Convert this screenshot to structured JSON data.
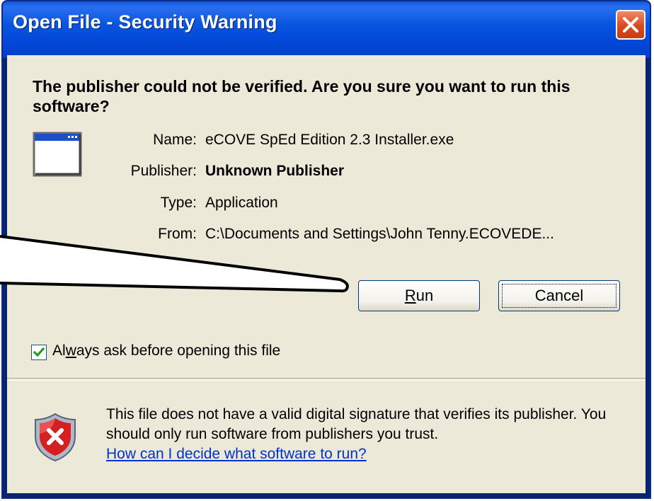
{
  "window": {
    "title": "Open File - Security Warning"
  },
  "dialog": {
    "heading": "The publisher could not be verified.  Are you sure you want to run this software?",
    "fields": {
      "name_label": "Name:",
      "name_value": "eCOVE SpEd Edition 2.3 Installer.exe",
      "publisher_label": "Publisher:",
      "publisher_value": "Unknown Publisher",
      "type_label": "Type:",
      "type_value": "Application",
      "from_label": "From:",
      "from_value": "C:\\Documents and Settings\\John Tenny.ECOVEDE..."
    },
    "buttons": {
      "run_prefix": "R",
      "run_rest": "un",
      "cancel": "Cancel"
    },
    "checkbox": {
      "label_before": "Al",
      "label_mnemonic": "w",
      "label_after": "ays ask before opening this file",
      "checked": true
    },
    "warning": {
      "text": "This file does not have a valid digital signature that verifies its publisher.  You should only run software from publishers you trust.",
      "link": "How can I decide what software to run?"
    }
  },
  "icons": {
    "close": "close-icon",
    "app": "application-window-icon",
    "shield": "security-shield-error-icon",
    "check": "checkmark-icon"
  },
  "colors": {
    "titlebar": "#0348d8",
    "client": "#ece9d8",
    "close_button": "#d84a20",
    "link": "#0033cc"
  }
}
